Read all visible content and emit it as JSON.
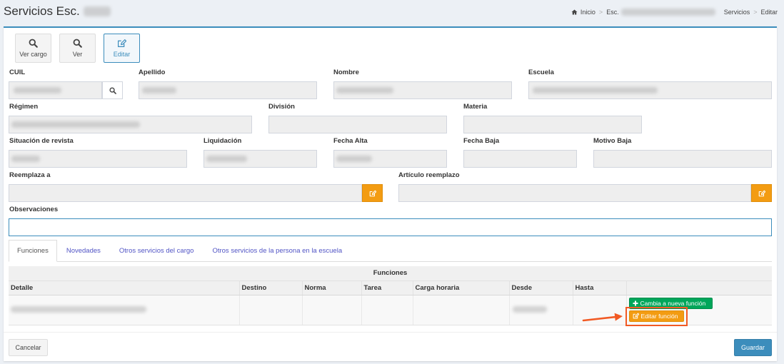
{
  "page": {
    "title": "Servicios Esc."
  },
  "breadcrumb": {
    "home": "Inicio",
    "separator": ">",
    "school_prefix": "Esc.",
    "section": "Servicios",
    "current": "Editar"
  },
  "toolbar": {
    "ver_cargo": "Ver cargo",
    "ver": "Ver",
    "editar": "Editar"
  },
  "form": {
    "cuil": "CUIL",
    "apellido": "Apellido",
    "nombre": "Nombre",
    "escuela": "Escuela",
    "regimen": "Régimen",
    "division": "División",
    "materia": "Materia",
    "situacion_revista": "Situación de revista",
    "liquidacion": "Liquidación",
    "fecha_alta": "Fecha Alta",
    "fecha_baja": "Fecha Baja",
    "motivo_baja": "Motivo Baja",
    "reemplaza_a": "Reemplaza a",
    "articulo_reemplazo": "Artículo reemplazo",
    "observaciones": "Observaciones"
  },
  "tabs": {
    "items": [
      {
        "label": "Funciones",
        "active": true
      },
      {
        "label": "Novedades",
        "active": false
      },
      {
        "label": "Otros servicios del cargo",
        "active": false
      },
      {
        "label": "Otros servicios de la persona en la escuela",
        "active": false
      }
    ]
  },
  "table": {
    "caption": "Funciones",
    "columns": [
      "Detalle",
      "Destino",
      "Norma",
      "Tarea",
      "Carga horaria",
      "Desde",
      "Hasta"
    ],
    "row_actions": {
      "change_function": "Cambia a nueva función",
      "edit_function": "Editar función"
    }
  },
  "footer": {
    "cancel": "Cancelar",
    "save": "Guardar"
  },
  "colors": {
    "primary": "#3c8dbc",
    "warning": "#f39c12",
    "success": "#00a65a",
    "highlight": "#f15a24",
    "tab_link": "#5154c5"
  },
  "icons": {
    "home": "home-icon",
    "search": "search-icon",
    "edit": "edit-icon",
    "plus": "plus-icon",
    "annotation": "arrow-right-icon"
  }
}
